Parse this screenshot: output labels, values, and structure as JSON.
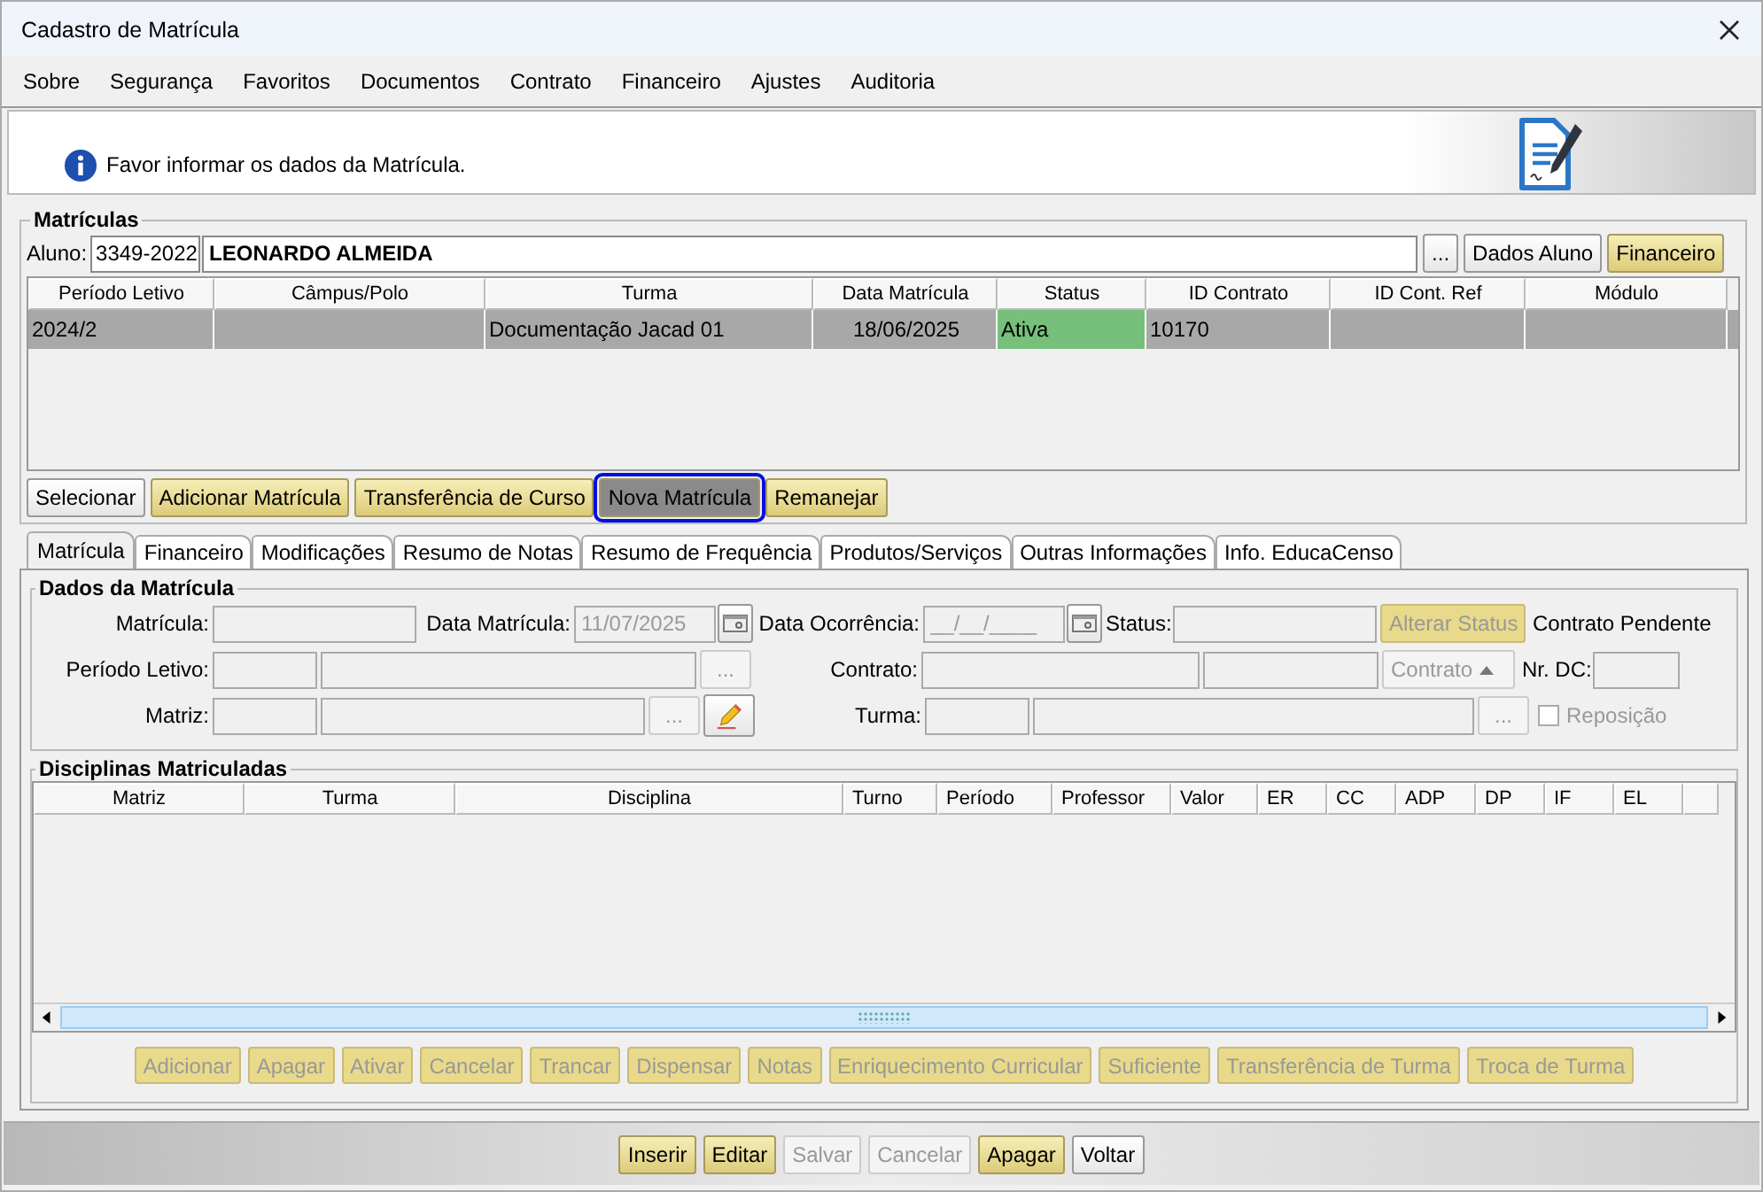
{
  "window": {
    "title": "Cadastro de Matrícula"
  },
  "menu": [
    "Sobre",
    "Segurança",
    "Favoritos",
    "Documentos",
    "Contrato",
    "Financeiro",
    "Ajustes",
    "Auditoria"
  ],
  "info": {
    "message": "Favor informar os dados da Matrícula."
  },
  "matriculas": {
    "title": "Matrículas",
    "aluno_label": "Aluno:",
    "aluno_code": "3349-2022",
    "aluno_name": "LEONARDO ALMEIDA",
    "aluno_buttons": [
      {
        "label": "...",
        "kind": "plain",
        "disabled": false
      },
      {
        "label": "Dados Aluno",
        "kind": "plain",
        "disabled": false
      },
      {
        "label": "Financeiro",
        "kind": "gold",
        "disabled": false
      }
    ],
    "table": {
      "columns": [
        "Período Letivo",
        "Câmpus/Polo",
        "Turma",
        "Data Matrícula",
        "Status",
        "ID Contrato",
        "ID Cont. Ref",
        "Módulo"
      ],
      "rows": [
        {
          "cells": [
            {
              "text": "2024/2"
            },
            {
              "text": ""
            },
            {
              "text": "Documentação Jacad 01"
            },
            {
              "text": "18/06/2025"
            },
            {
              "text": "Ativa",
              "color": "#77c07b"
            },
            {
              "text": "10170"
            },
            {
              "text": ""
            },
            {
              "text": ""
            }
          ],
          "selected": true
        }
      ]
    },
    "actions": [
      {
        "label": "Selecionar",
        "kind": "plain",
        "focused": false
      },
      {
        "label": "Adicionar Matrícula",
        "kind": "gold",
        "focused": false
      },
      {
        "label": "Transferência de Curso",
        "kind": "gold",
        "focused": false
      },
      {
        "label": "Nova Matrícula",
        "kind": "gold",
        "focused": true
      },
      {
        "label": "Remanejar",
        "kind": "gold",
        "focused": false
      }
    ]
  },
  "tabs": [
    {
      "label": "Matrícula",
      "selected": true
    },
    {
      "label": "Financeiro",
      "selected": false
    },
    {
      "label": "Modificações",
      "selected": false
    },
    {
      "label": "Resumo de Notas",
      "selected": false
    },
    {
      "label": "Resumo de Frequência",
      "selected": false
    },
    {
      "label": "Produtos/Serviços",
      "selected": false
    },
    {
      "label": "Outras Informações",
      "selected": false
    },
    {
      "label": "Info. EducaCenso",
      "selected": false
    }
  ],
  "dados": {
    "title": "Dados da Matrícula",
    "matricula_label": "Matrícula:",
    "data_matricula_label": "Data Matrícula:",
    "data_matricula_value": "11/07/2025",
    "data_ocorrencia_label": "Data Ocorrência:",
    "data_ocorrencia_placeholder": "__/__/____",
    "status_label": "Status:",
    "alterar_status": {
      "label": "Alterar Status",
      "disabled": true
    },
    "contrato_pendente": "Contrato Pendente",
    "periodo_label": "Período Letivo:",
    "periodo_button": "...",
    "contrato_label": "Contrato:",
    "contrato_button": {
      "label": "Contrato",
      "disabled": true
    },
    "nr_dc_label": "Nr. DC:",
    "matriz_label": "Matriz:",
    "matriz_button": "...",
    "turma_label": "Turma:",
    "turma_button": "...",
    "reposicao": {
      "label": "Reposição",
      "checked": false,
      "disabled": true
    }
  },
  "disciplinas": {
    "title": "Disciplinas Matriculadas",
    "columns": [
      "Matriz",
      "Turma",
      "Disciplina",
      "Turno",
      "Período",
      "Professor",
      "Valor",
      "ER",
      "CC",
      "ADP",
      "DP",
      "IF",
      "EL"
    ],
    "actions": [
      {
        "label": "Adicionar",
        "disabled": true
      },
      {
        "label": "Apagar",
        "disabled": true
      },
      {
        "label": "Ativar",
        "disabled": true
      },
      {
        "label": "Cancelar",
        "disabled": true
      },
      {
        "label": "Trancar",
        "disabled": true
      },
      {
        "label": "Dispensar",
        "disabled": true
      },
      {
        "label": "Notas",
        "disabled": true
      },
      {
        "label": "Enriquecimento Curricular",
        "disabled": true
      },
      {
        "label": "Suficiente",
        "disabled": true
      },
      {
        "label": "Transferência de Turma",
        "disabled": true
      },
      {
        "label": "Troca de Turma",
        "disabled": true
      }
    ]
  },
  "bottom_buttons": [
    {
      "label": "Inserir",
      "kind": "gold",
      "disabled": false
    },
    {
      "label": "Editar",
      "kind": "gold",
      "disabled": false
    },
    {
      "label": "Salvar",
      "kind": "plain",
      "disabled": true
    },
    {
      "label": "Cancelar",
      "kind": "plain",
      "disabled": true
    },
    {
      "label": "Apagar",
      "kind": "gold",
      "disabled": false
    },
    {
      "label": "Voltar",
      "kind": "plain",
      "disabled": false
    }
  ]
}
